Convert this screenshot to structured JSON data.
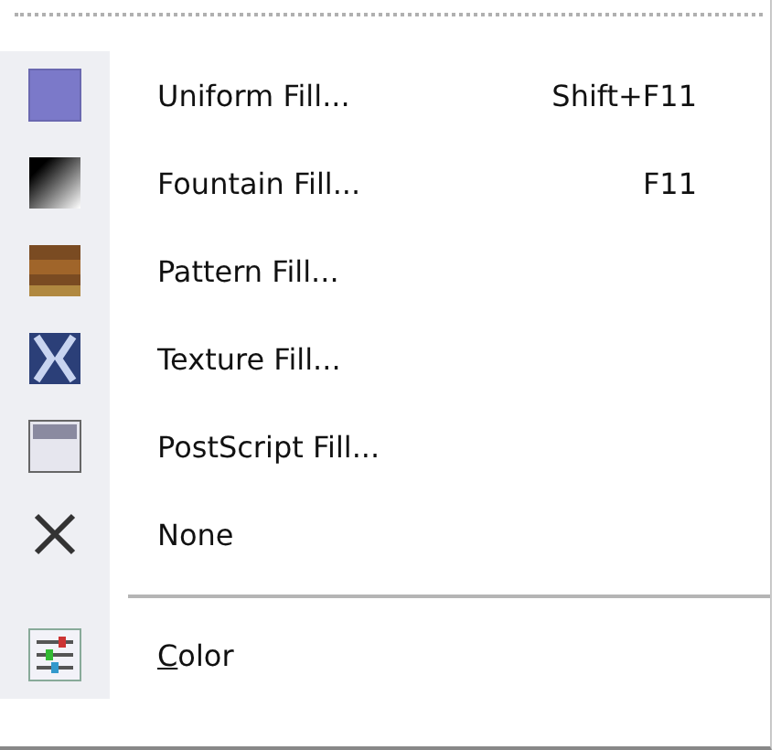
{
  "menu": {
    "items": [
      {
        "kind": "uniform",
        "label": "Uniform Fill...",
        "shortcut": "Shift+F11"
      },
      {
        "kind": "fountain",
        "label": "Fountain Fill...",
        "shortcut": "F11"
      },
      {
        "kind": "pattern",
        "label": "Pattern Fill..."
      },
      {
        "kind": "texture",
        "label": "Texture Fill..."
      },
      {
        "kind": "postscript",
        "label": "PostScript Fill..."
      },
      {
        "kind": "none",
        "label": "None"
      },
      {
        "kind": "separator"
      },
      {
        "kind": "color",
        "label": "Color",
        "mnemonic_first": true
      }
    ]
  }
}
